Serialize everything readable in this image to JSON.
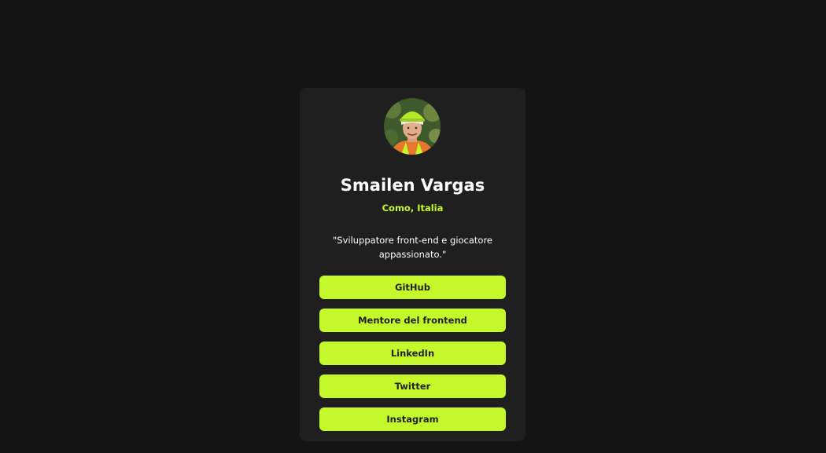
{
  "profile": {
    "avatar_alt": "profile photo",
    "name": "Smailen Vargas",
    "location": "Como, Italia",
    "bio": "\"Sviluppatore front-end e giocatore appassionato.\""
  },
  "links": [
    {
      "label": "GitHub"
    },
    {
      "label": "Mentore del frontend"
    },
    {
      "label": "LinkedIn"
    },
    {
      "label": "Twitter"
    },
    {
      "label": "Instagram"
    }
  ],
  "colors": {
    "page_background": "#141414",
    "card_background": "#1f1f1f",
    "accent": "#c4f82a",
    "text_primary": "#ffffff",
    "button_text": "#1f1f1f"
  }
}
